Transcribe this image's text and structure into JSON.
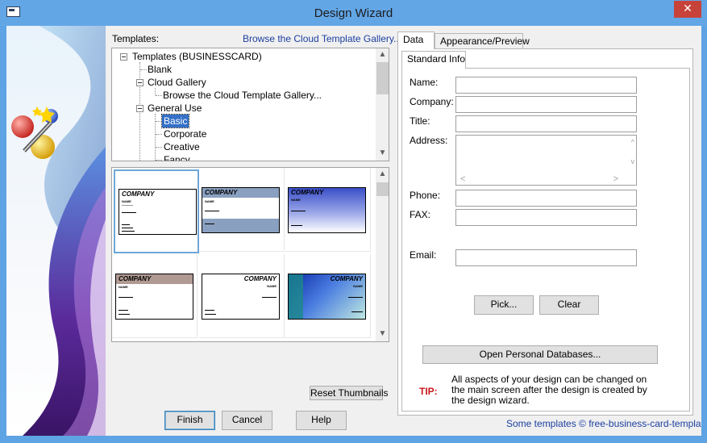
{
  "window": {
    "title": "Design Wizard",
    "close_glyph": "✕"
  },
  "templates": {
    "label": "Templates:",
    "browse_link": "Browse the Cloud Template Gallery...",
    "tree": {
      "root": "Templates (BUSINESSCARD)",
      "blank": "Blank",
      "cloud": "Cloud Gallery",
      "cloud_browse": "Browse the Cloud Template Gallery...",
      "general": "General Use",
      "basic": "Basic",
      "corporate": "Corporate",
      "creative": "Creative",
      "fancy": "Fancy"
    },
    "thumbnails": [
      {
        "company": "COMPANY",
        "name": "NAME",
        "style": "plain",
        "selected": true
      },
      {
        "company": "COMPANY",
        "name": "NAME",
        "style": "blue-bands",
        "selected": false
      },
      {
        "company": "COMPANY",
        "name": "NAME",
        "style": "purple-gradient",
        "selected": false
      },
      {
        "company": "COMPANY",
        "name": "NAME",
        "style": "brown-band",
        "selected": false
      },
      {
        "company": "COMPANY",
        "name": "NAME",
        "style": "plain-right",
        "selected": false
      },
      {
        "company": "COMPANY",
        "name": "NAME",
        "style": "blue-green",
        "selected": false
      }
    ],
    "reset_thumbnails": "Reset Thumbnails"
  },
  "buttons": {
    "finish": "Finish",
    "cancel": "Cancel",
    "help": "Help"
  },
  "tabs": {
    "data": "Data",
    "appearance": "Appearance/Preview",
    "standard_info": "Standard Info"
  },
  "form": {
    "name": {
      "label": "Name:",
      "value": ""
    },
    "company": {
      "label": "Company:",
      "value": ""
    },
    "title": {
      "label": "Title:",
      "value": ""
    },
    "address": {
      "label": "Address:",
      "value": ""
    },
    "phone": {
      "label": "Phone:",
      "value": ""
    },
    "fax": {
      "label": "FAX:",
      "value": ""
    },
    "email": {
      "label": "Email:",
      "value": ""
    },
    "pick": "Pick...",
    "clear": "Clear",
    "open_db": "Open Personal Databases..."
  },
  "tip": {
    "label": "TIP:",
    "line1": "All aspects of your design can be changed on",
    "line2": "the main screen after the design is created by",
    "line3": "the design wizard."
  },
  "footer": "Some templates © free-business-card-templates"
}
